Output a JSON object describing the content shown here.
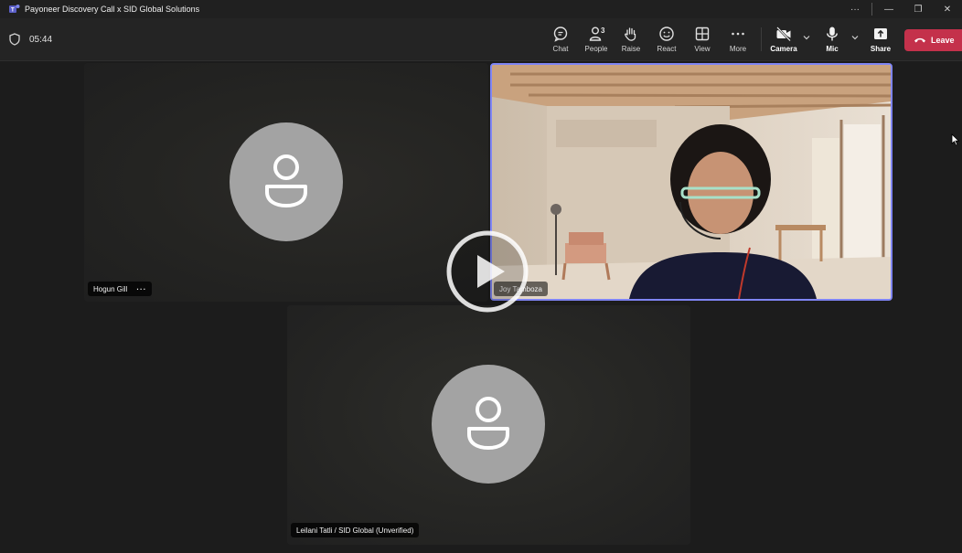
{
  "window": {
    "title": "Payoneer Discovery Call x SID Global Solutions",
    "controls": [
      "···",
      "—",
      "❐",
      "✕"
    ]
  },
  "toolbar": {
    "timer": "05:44",
    "buttons": [
      {
        "id": "chat",
        "label": "Chat",
        "icon": "chat-icon"
      },
      {
        "id": "people",
        "label": "People",
        "icon": "people-icon",
        "count": "3"
      },
      {
        "id": "raise",
        "label": "Raise",
        "icon": "hand-icon"
      },
      {
        "id": "react",
        "label": "React",
        "icon": "smile-icon"
      },
      {
        "id": "view",
        "label": "View",
        "icon": "grid-icon"
      },
      {
        "id": "more",
        "label": "More",
        "icon": "ellipsis-icon"
      },
      {
        "id": "camera",
        "label": "Camera",
        "icon": "camera-off-icon"
      },
      {
        "id": "mic",
        "label": "Mic",
        "icon": "mic-icon"
      },
      {
        "id": "share",
        "label": "Share",
        "icon": "share-icon"
      }
    ],
    "leave_label": "Leave"
  },
  "participants": [
    {
      "name": "Hogun Gill",
      "more": "···",
      "video": false
    },
    {
      "name": "Joy Tamboza",
      "video": true
    },
    {
      "name": "Leilani Tatli / SID Global (Unverified)",
      "video": false
    }
  ],
  "colors": {
    "leave": "#c4314b",
    "active_speaker_border": "#7f85f5",
    "avatar_bg": "#a3a3a3",
    "background": "#1c1c1c"
  }
}
